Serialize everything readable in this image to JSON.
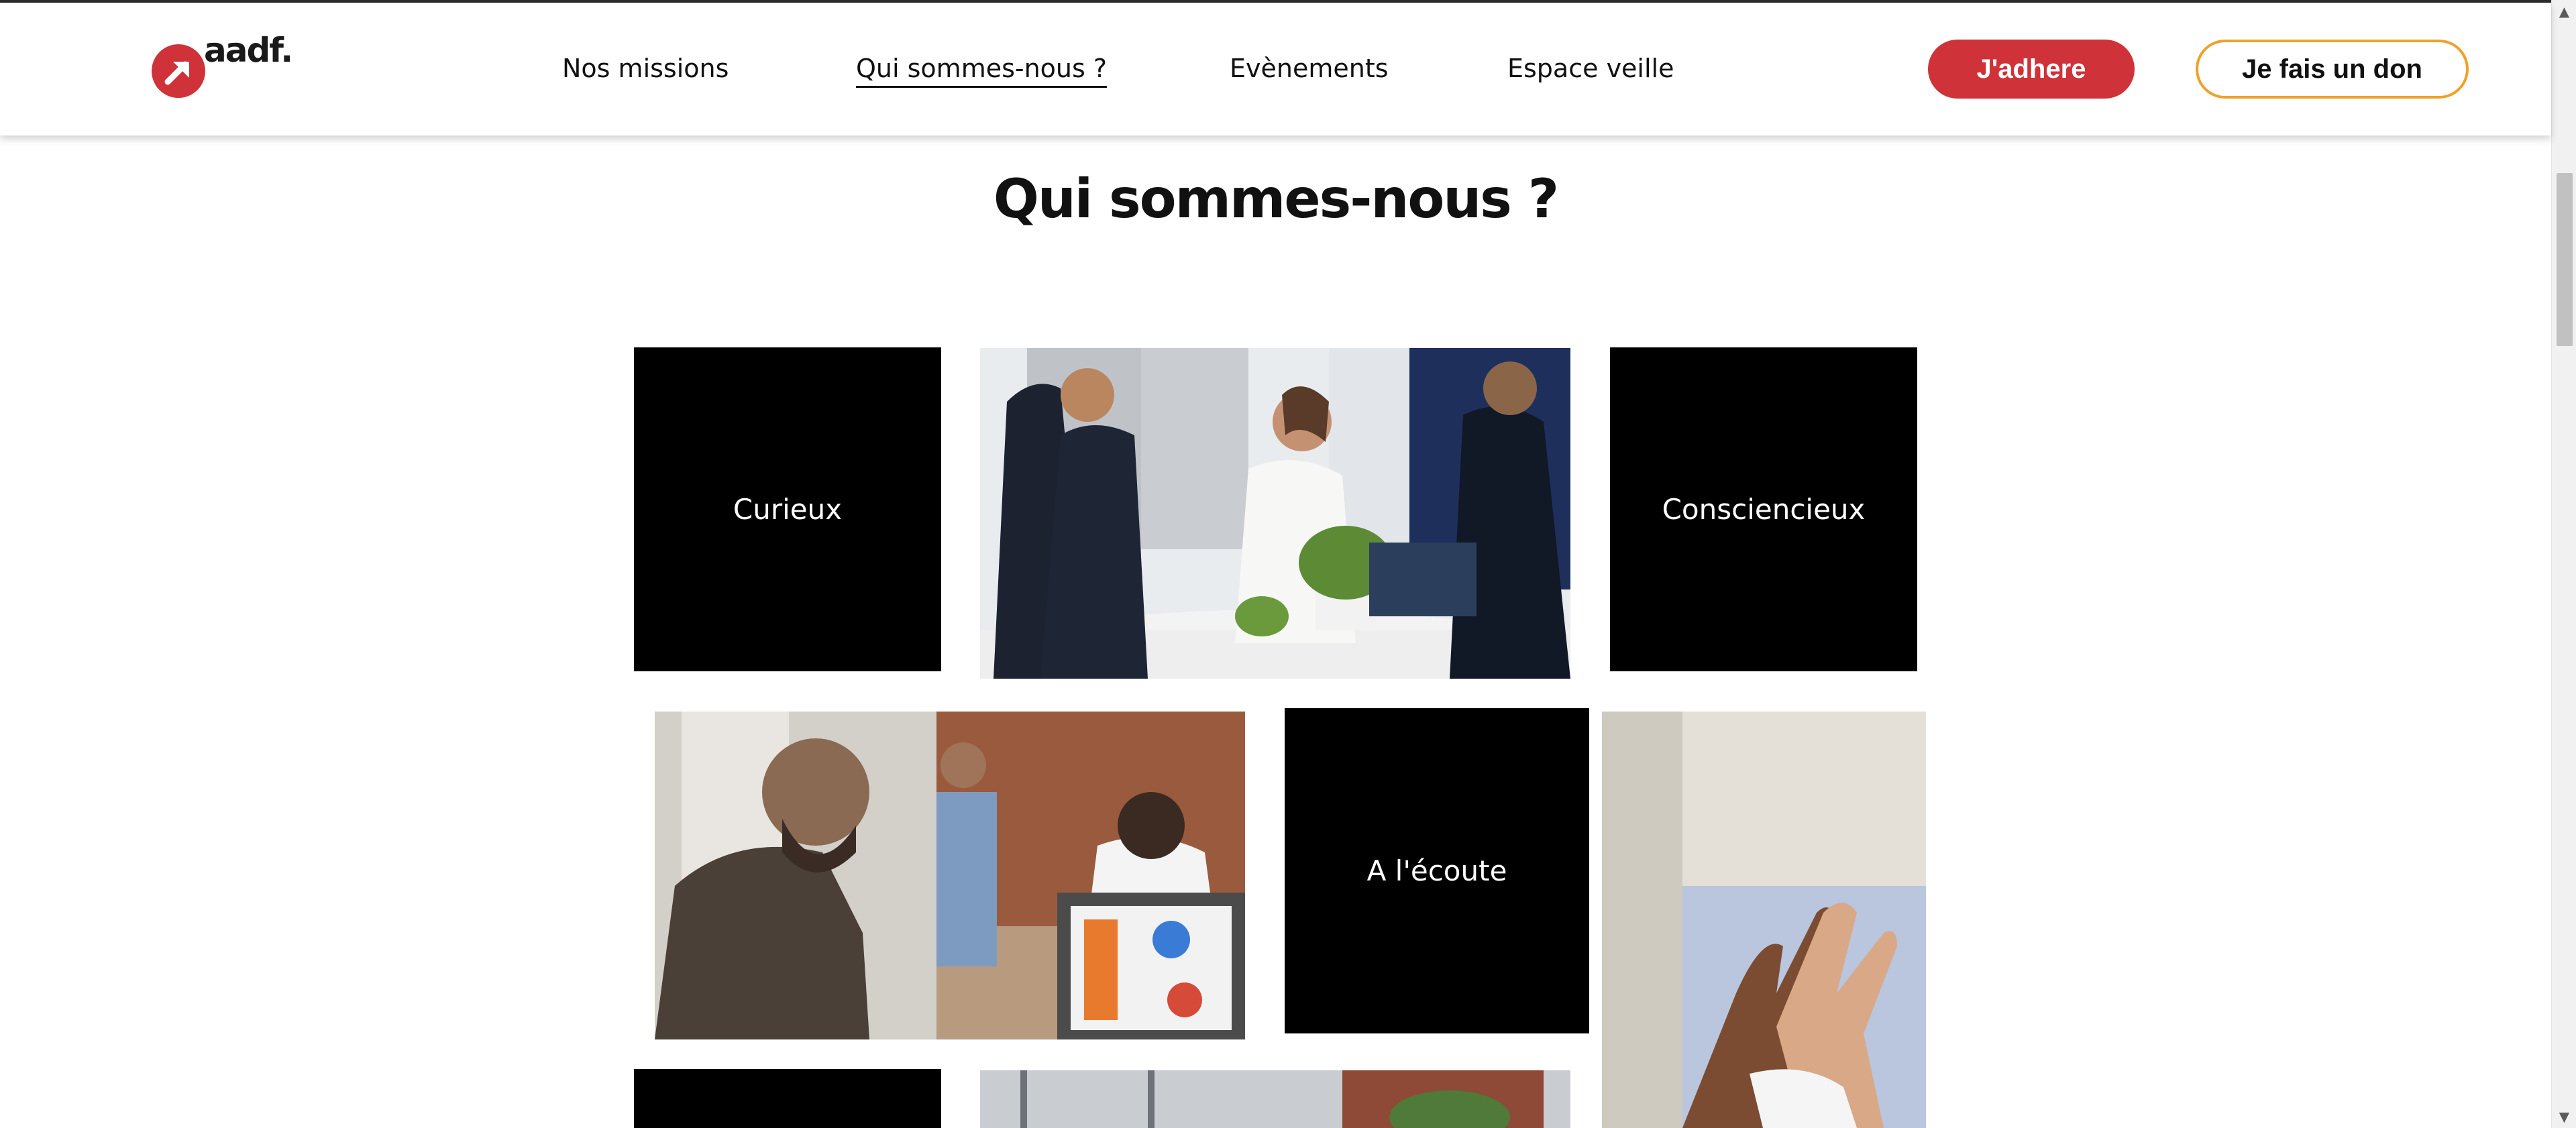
{
  "header": {
    "logo_text": "aadf.",
    "nav": [
      {
        "label": "Nos missions"
      },
      {
        "label": "Qui sommes-nous ?"
      },
      {
        "label": "Evènements"
      },
      {
        "label": "Espace veille"
      }
    ],
    "adhere_label": "J'adhere",
    "don_label": "Je fais un don"
  },
  "main": {
    "title": "Qui sommes-nous ?",
    "tiles": [
      {
        "label": "Curieux"
      },
      {
        "label": "Consciencieux"
      },
      {
        "label": "A l'écoute"
      }
    ]
  },
  "colors": {
    "brand_red": "#cf3239",
    "don_border": "#f0a12a",
    "tile_bg": "#000000"
  },
  "icons": {
    "logo": "arrow-up-right-icon",
    "scroll_up": "chevron-up-icon",
    "scroll_down": "chevron-down-icon"
  }
}
